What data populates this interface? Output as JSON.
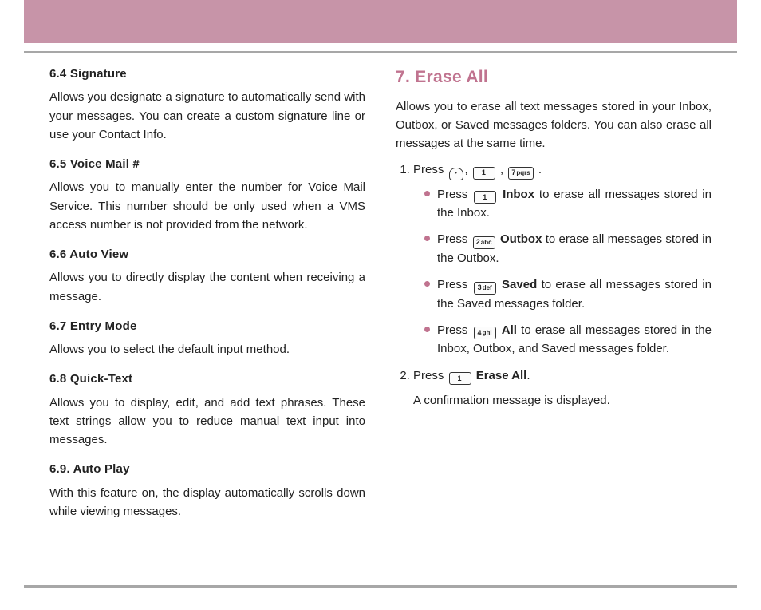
{
  "left": {
    "s64": {
      "h": "6.4 Signature",
      "p": "Allows you designate a signature to automatically send with your messages. You can create a custom signature line or use your Contact Info."
    },
    "s65": {
      "h": "6.5 Voice Mail #",
      "p": "Allows you to manually enter the number for Voice Mail Service. This number should be only used when a VMS access number is not provided from the network."
    },
    "s66": {
      "h": "6.6 Auto View",
      "p": "Allows you to directly display the content when receiving a message."
    },
    "s67": {
      "h": "6.7 Entry Mode",
      "p": "Allows you to select the default input method."
    },
    "s68": {
      "h": "6.8 Quick-Text",
      "p": "Allows you to display, edit, and add text phrases. These text strings allow you to reduce manual text input into messages."
    },
    "s69": {
      "h": "6.9. Auto Play",
      "p": "With this feature on, the display automatically scrolls down while viewing messages."
    }
  },
  "right": {
    "title": "7. Erase All",
    "intro": "Allows you to erase all text messages stored in your Inbox, Outbox, or Saved messages folders. You can also erase all messages at the same time.",
    "step1_prefix": "Press ",
    "bul1": {
      "pre": "Press ",
      "bold": "Inbox",
      "post": " to erase all messages stored in the Inbox."
    },
    "bul2": {
      "pre": "Press ",
      "bold": "Outbox",
      "post": " to erase all messages stored in the Outbox."
    },
    "bul3": {
      "pre": "Press ",
      "bold": "Saved",
      "post": " to erase all messages stored in the Saved messages folder."
    },
    "bul4": {
      "pre": "Press ",
      "bold": "All",
      "post": " to erase all messages stored in the Inbox, Outbox, and Saved messages folder."
    },
    "step2_pre": "Press ",
    "step2_bold": "Erase All",
    "step2_post": ".",
    "confirm": "A confirmation message is displayed."
  },
  "keys": {
    "k1": "1",
    "k1a": "",
    "k2": "2",
    "k2a": "abc",
    "k3": "3",
    "k3a": "def",
    "k4": "4",
    "k4a": "ghi",
    "k7": "7",
    "k7a": "pqrs"
  }
}
